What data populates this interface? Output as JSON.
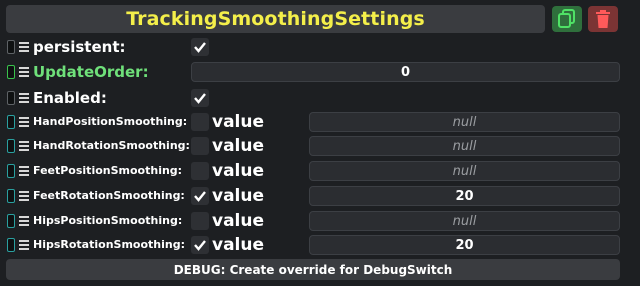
{
  "title": "TrackingSmoothingSettings",
  "colors": {
    "title": "#f4ef4a",
    "label_green": "#6fe07a",
    "duplicate_button": "#2f6f3c",
    "delete_button": "#7b3434",
    "handle_teal": "#2aa0a0",
    "handle_green": "#39c24b"
  },
  "toolbar": {
    "duplicate_icon": "copy-icon",
    "delete_icon": "trash-icon"
  },
  "fields": [
    {
      "label": "persistent:",
      "checked": true
    },
    {
      "label": "UpdateOrder:",
      "value": "0"
    },
    {
      "label": "Enabled:",
      "checked": true
    }
  ],
  "value_word": "value",
  "smoothing": [
    {
      "label": "HandPositionSmoothing:",
      "checked": false,
      "value": "null"
    },
    {
      "label": "HandRotationSmoothing:",
      "checked": false,
      "value": "null"
    },
    {
      "label": "FeetPositionSmoothing:",
      "checked": false,
      "value": "null"
    },
    {
      "label": "FeetRotationSmoothing:",
      "checked": true,
      "value": "20"
    },
    {
      "label": "HipsPositionSmoothing:",
      "checked": false,
      "value": "null"
    },
    {
      "label": "HipsRotationSmoothing:",
      "checked": true,
      "value": "20"
    }
  ],
  "debug_button": "DEBUG: Create override for DebugSwitch"
}
